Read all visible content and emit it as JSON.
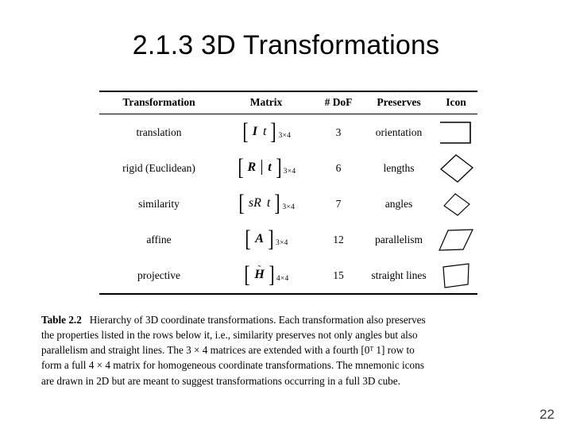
{
  "slide": {
    "title": "2.1.3 3D Transformations",
    "page_number": "22"
  },
  "table": {
    "headers": {
      "transformation": "Transformation",
      "matrix": "Matrix",
      "dof": "# DoF",
      "preserves": "Preserves",
      "icon": "Icon"
    },
    "rows": [
      {
        "name": "translation",
        "matrix_symbols": "I  t",
        "matrix_sub": "3×4",
        "dof": "3",
        "preserves": "orientation",
        "icon": "open-square-icon"
      },
      {
        "name": "rigid (Euclidean)",
        "matrix_symbols": "R | t",
        "matrix_sub": "3×4",
        "dof": "6",
        "preserves": "lengths",
        "icon": "rotated-square-icon"
      },
      {
        "name": "similarity",
        "matrix_symbols": "sR  t",
        "matrix_sub": "3×4",
        "dof": "7",
        "preserves": "angles",
        "icon": "small-rotated-square-icon"
      },
      {
        "name": "affine",
        "matrix_symbols": "A",
        "matrix_sub": "3×4",
        "dof": "12",
        "preserves": "parallelism",
        "icon": "parallelogram-icon"
      },
      {
        "name": "projective",
        "matrix_symbols": "H̃",
        "matrix_sub": "4×4",
        "dof": "15",
        "preserves": "straight lines",
        "icon": "trapezoid-icon"
      }
    ],
    "symbols": {
      "bracket_left": "[",
      "bracket_right": "]",
      "identity": "I",
      "translation_vec": "t",
      "rotation": "R",
      "scale_rotation": "sR",
      "affine_mat": "A",
      "projective_mat": "H",
      "tilde": "˜",
      "sub_3x4": "3×4",
      "sub_4x4": "4×4",
      "scale_s": "s"
    }
  },
  "caption": {
    "label": "Table 2.2",
    "lines": [
      "Hierarchy of 3D coordinate transformations. Each transformation also preserves",
      "the properties listed in the rows below it, i.e., similarity preserves not only angles but also",
      "parallelism and straight lines. The 3 × 4 matrices are extended with a fourth [0ᵀ 1] row to",
      "form a full 4 × 4 matrix for homogeneous coordinate transformations. The mnemonic icons",
      "are drawn in 2D but are meant to suggest transformations occurring in a full 3D cube."
    ]
  },
  "colors": {
    "text": "#000000",
    "background": "#ffffff",
    "rule": "#000000",
    "page_number": "#3b3b3b"
  }
}
